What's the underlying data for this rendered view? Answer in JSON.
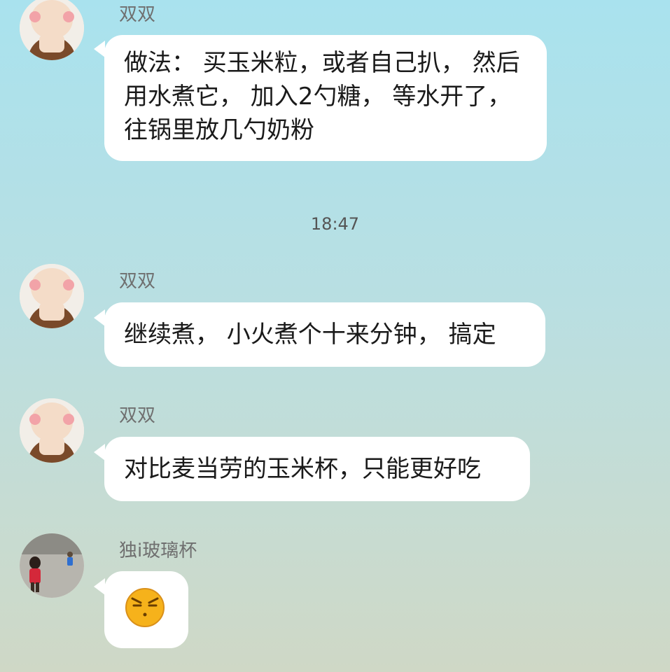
{
  "timestamp": "18:47",
  "messages": [
    {
      "sender": "双双",
      "text": "做法： 买玉米粒，或者自己扒， 然后用水煮它， 加入2勺糖， 等水开了， 往锅里放几勺奶粉"
    },
    {
      "sender": "双双",
      "text": "继续煮， 小火煮个十来分钟， 搞定"
    },
    {
      "sender": "双双",
      "text": "对比麦当劳的玉米杯，只能更好吃"
    },
    {
      "sender": "独i玻璃杯",
      "text": ""
    }
  ],
  "icons": {
    "monkey_avatar": "monkey-avatar-icon",
    "child_photo_avatar": "child-photo-avatar",
    "emoji": "annoyed-face-emoji"
  },
  "colors": {
    "bubble": "#ffffff",
    "emoji_face": "#f6b21b"
  }
}
